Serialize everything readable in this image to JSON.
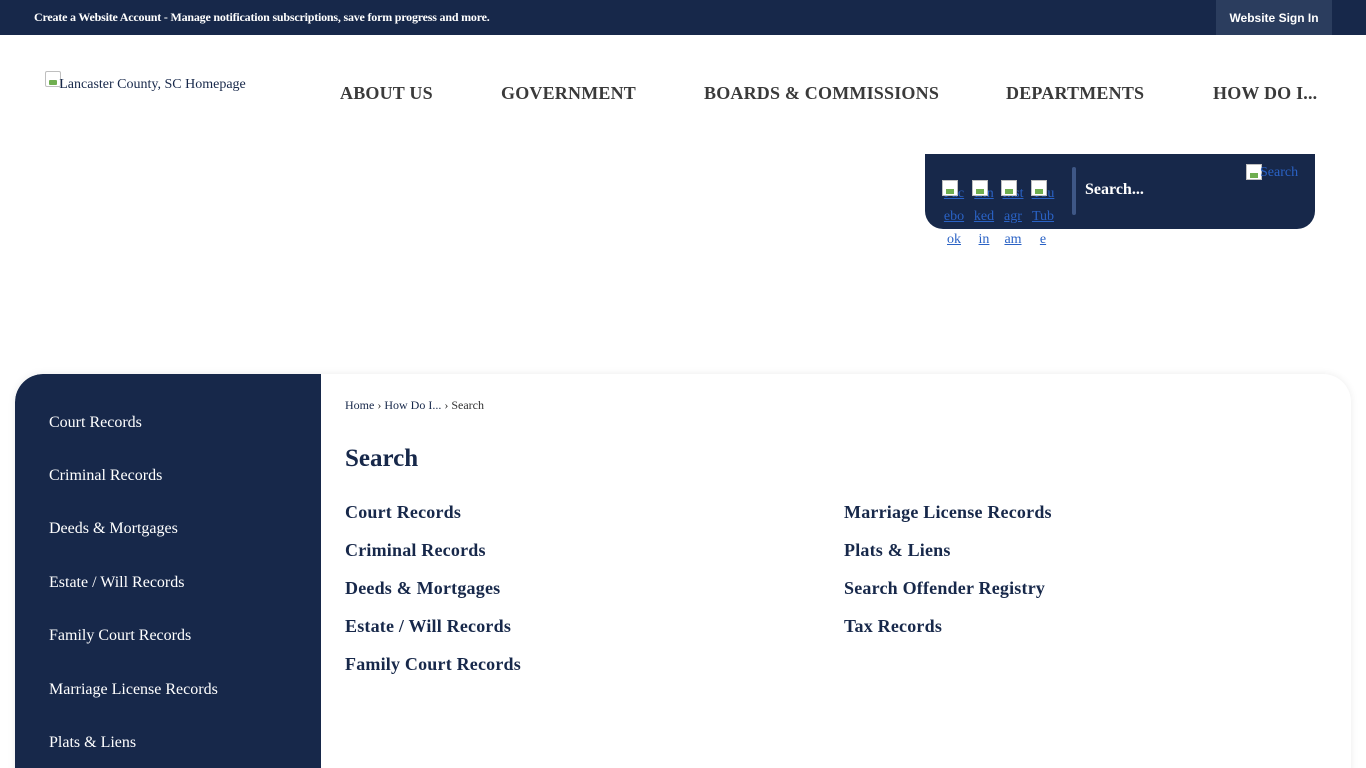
{
  "topbar": {
    "message": "Create a Website Account - Manage notification subscriptions, save form progress and more.",
    "signin_label": "Website Sign In"
  },
  "header": {
    "logo_alt": "Lancaster County, SC Homepage",
    "nav": [
      "ABOUT US",
      "GOVERNMENT",
      "BOARDS & COMMISSIONS",
      "DEPARTMENTS",
      "HOW DO I..."
    ]
  },
  "search": {
    "social": [
      "Facebook",
      "Linkedin",
      "Instagram",
      "YouTube"
    ],
    "placeholder": "Search...",
    "button_alt": "Search"
  },
  "sidebar": {
    "items": [
      "Court Records",
      "Criminal Records",
      "Deeds & Mortgages",
      "Estate / Will Records",
      "Family Court Records",
      "Marriage License Records",
      "Plats & Liens"
    ]
  },
  "breadcrumb": {
    "home": "Home",
    "section": "How Do I...",
    "current": "Search",
    "separator": "›"
  },
  "main": {
    "title": "Search",
    "links_col1": [
      "Court Records",
      "Criminal Records",
      "Deeds & Mortgages",
      "Estate / Will Records",
      "Family Court Records"
    ],
    "links_col2": [
      "Marriage License Records",
      "Plats & Liens",
      "Search Offender Registry",
      "Tax Records"
    ]
  },
  "colors": {
    "navy": "#17284a",
    "signin_bg": "#2b3d5e",
    "link_blue": "#2a62c5"
  }
}
